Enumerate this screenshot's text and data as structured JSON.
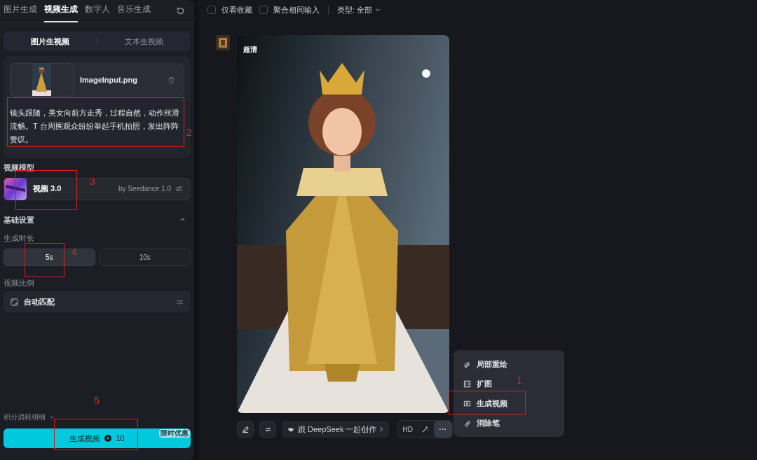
{
  "top_tabs": [
    {
      "label": "图片生成",
      "selected": false
    },
    {
      "label": "视频生成",
      "selected": true
    },
    {
      "label": "数字人",
      "selected": false
    },
    {
      "label": "音乐生成",
      "selected": false
    }
  ],
  "mode_tabs": [
    {
      "label": "图片生视频",
      "selected": true
    },
    {
      "label": "文本生视频",
      "selected": false
    }
  ],
  "image_input": {
    "filename": "ImageInput.png"
  },
  "prompt": "镜头跟随，美女向前方走秀，过程自然，动作丝滑流畅。T 台周围观众纷纷举起手机拍照，发出阵阵赞叹。",
  "model_section": {
    "heading": "视频模型",
    "name": "视频 3.0",
    "provider": "by Seedance 1.0"
  },
  "basic_settings": {
    "heading": "基础设置",
    "expanded": true,
    "duration": {
      "label": "生成时长",
      "options": [
        {
          "label": "5s",
          "selected": true
        },
        {
          "label": "10s",
          "selected": false
        }
      ]
    },
    "ratio": {
      "label": "视频比例",
      "value": "自动匹配"
    }
  },
  "cost_details": "积分消耗明细",
  "generate_button": {
    "label": "生成视频",
    "cost": "10",
    "badge": "限时优惠"
  },
  "filters": [
    {
      "label": "仅看收藏",
      "checked": false
    },
    {
      "label": "聚合相同输入",
      "checked": false
    }
  ],
  "type_filter": "类型: 全部",
  "result": {
    "quality_tag": "超清"
  },
  "toolbar": {
    "deepseek": "跟 DeepSeek 一起创作",
    "hd": "HD"
  },
  "more_menu": [
    {
      "label": "局部重绘"
    },
    {
      "label": "扩图"
    },
    {
      "label": "生成视频"
    },
    {
      "label": "消除笔"
    }
  ],
  "annotations": [
    {
      "label": "1"
    },
    {
      "label": "2"
    },
    {
      "label": "3"
    },
    {
      "label": "4"
    },
    {
      "label": "5"
    }
  ]
}
